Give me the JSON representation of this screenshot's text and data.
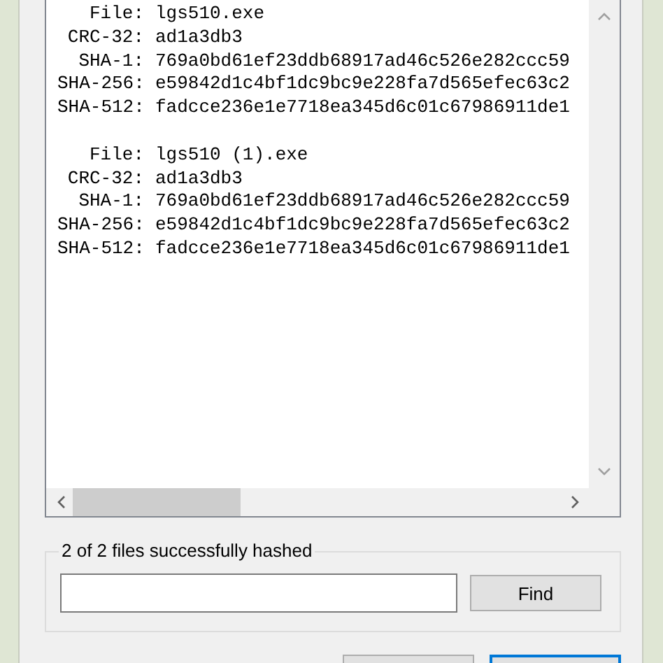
{
  "results": [
    {
      "fields": [
        {
          "label": "File:",
          "value": "lgs510.exe"
        },
        {
          "label": "CRC-32:",
          "value": "ad1a3db3"
        },
        {
          "label": "SHA-1:",
          "value": "769a0bd61ef23ddb68917ad46c526e282ccc59"
        },
        {
          "label": "SHA-256:",
          "value": "e59842d1c4bf1dc9bc9e228fa7d565efec63c2"
        },
        {
          "label": "SHA-512:",
          "value": "fadcce236e1e7718ea345d6c01c67986911de1"
        }
      ]
    },
    {
      "fields": [
        {
          "label": "File:",
          "value": "lgs510 (1).exe"
        },
        {
          "label": "CRC-32:",
          "value": "ad1a3db3"
        },
        {
          "label": "SHA-1:",
          "value": "769a0bd61ef23ddb68917ad46c526e282ccc59"
        },
        {
          "label": "SHA-256:",
          "value": "e59842d1c4bf1dc9bc9e228fa7d565efec63c2"
        },
        {
          "label": "SHA-512:",
          "value": "fadcce236e1e7718ea345d6c01c67986911de1"
        }
      ]
    }
  ],
  "find_group": {
    "title": "2 of 2 files successfully hashed",
    "find_button": "Find"
  },
  "dialog_buttons": [
    {
      "default": false
    },
    {
      "default": true
    }
  ]
}
